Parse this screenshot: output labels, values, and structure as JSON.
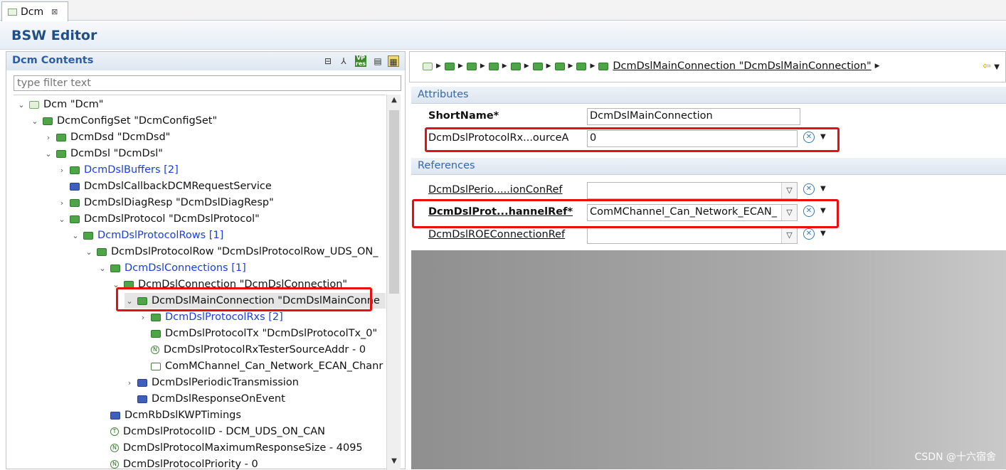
{
  "tab": {
    "label": "Dcm"
  },
  "header": {
    "title": "BSW Editor"
  },
  "outline": {
    "title": "Dcm Contents",
    "filter_placeholder": "type filter text",
    "tree": [
      {
        "label": "Dcm \"Dcm\"",
        "indent": 0,
        "toggle": "v",
        "icon": "root"
      },
      {
        "label": "DcmConfigSet \"DcmConfigSet\"",
        "indent": 1,
        "toggle": "v",
        "icon": "folder"
      },
      {
        "label": "DcmDsd \"DcmDsd\"",
        "indent": 2,
        "toggle": ">",
        "icon": "folder"
      },
      {
        "label": "DcmDsl \"DcmDsl\"",
        "indent": 2,
        "toggle": "v",
        "icon": "folder"
      },
      {
        "label": "DcmDslBuffers [2]",
        "indent": 3,
        "toggle": ">",
        "icon": "folder",
        "link": true
      },
      {
        "label": "DcmDslCallbackDCMRequestService",
        "indent": 3,
        "toggle": "",
        "icon": "blue"
      },
      {
        "label": "DcmDslDiagResp \"DcmDslDiagResp\"",
        "indent": 3,
        "toggle": ">",
        "icon": "folder"
      },
      {
        "label": "DcmDslProtocol \"DcmDslProtocol\"",
        "indent": 3,
        "toggle": "v",
        "icon": "folder"
      },
      {
        "label": "DcmDslProtocolRows [1]",
        "indent": 4,
        "toggle": "v",
        "icon": "folder",
        "link": true
      },
      {
        "label": "DcmDslProtocolRow \"DcmDslProtocolRow_UDS_ON_",
        "indent": 5,
        "toggle": "v",
        "icon": "folder"
      },
      {
        "label": "DcmDslConnections [1]",
        "indent": 6,
        "toggle": "v",
        "icon": "folder",
        "link": true
      },
      {
        "label": "DcmDslConnection \"DcmDslConnection\"",
        "indent": 7,
        "toggle": "v",
        "icon": "folder"
      },
      {
        "label": "DcmDslMainConnection \"DcmDslMainConne",
        "indent": 8,
        "toggle": "v",
        "icon": "folder",
        "selected": true
      },
      {
        "label": "DcmDslProtocolRxs [2]",
        "indent": 9,
        "toggle": ">",
        "icon": "folder",
        "link": true
      },
      {
        "label": "DcmDslProtocolTx \"DcmDslProtocolTx_0\"",
        "indent": 9,
        "toggle": "",
        "icon": "folder"
      },
      {
        "label": "DcmDslProtocolRxTesterSourceAddr - 0",
        "indent": 9,
        "toggle": "",
        "icon": "circ",
        "glyph": "N"
      },
      {
        "label": "ComMChannel_Can_Network_ECAN_Chanr",
        "indent": 9,
        "toggle": "",
        "icon": "link"
      },
      {
        "label": "DcmDslPeriodicTransmission",
        "indent": 8,
        "toggle": ">",
        "icon": "blue"
      },
      {
        "label": "DcmDslResponseOnEvent",
        "indent": 8,
        "toggle": "",
        "icon": "blue"
      },
      {
        "label": "DcmRbDslKWPTimings",
        "indent": 6,
        "toggle": "",
        "icon": "blue"
      },
      {
        "label": "DcmDslProtocolID - DCM_UDS_ON_CAN",
        "indent": 6,
        "toggle": "",
        "icon": "circ",
        "glyph": "T"
      },
      {
        "label": "DcmDslProtocolMaximumResponseSize - 4095",
        "indent": 6,
        "toggle": "",
        "icon": "circ",
        "glyph": "N"
      },
      {
        "label": "DcmDslProtocolPriority - 0",
        "indent": 6,
        "toggle": "",
        "icon": "circ",
        "glyph": "N"
      }
    ]
  },
  "breadcrumb": {
    "current": "DcmDslMainConnection \"DcmDslMainConnection\""
  },
  "attributes": {
    "title": "Attributes",
    "short_name_label": "ShortName*",
    "short_name_value": "DcmDslMainConnection",
    "rx_source_label": "DcmDslProtocolRx...ourceA",
    "rx_source_value": "0"
  },
  "references": {
    "title": "References",
    "periodic_label": "DcmDslPerio.....ionConRef",
    "periodic_value": "",
    "channel_label": "DcmDslProt...hannelRef*",
    "channel_value": "ComMChannel_Can_Network_ECAN_",
    "roe_label": "DcmDslROEConnectionRef",
    "roe_value": ""
  },
  "watermark": "CSDN @十六宿舍"
}
